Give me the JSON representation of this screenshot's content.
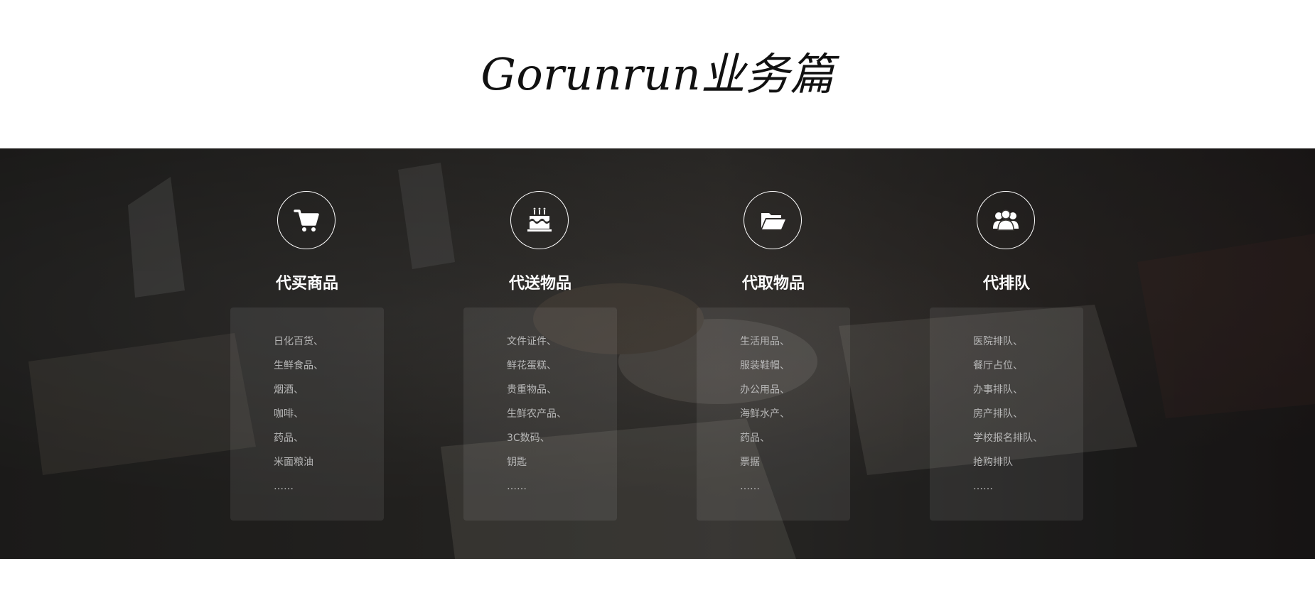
{
  "page": {
    "title": "Gorunrun业务篇"
  },
  "services": [
    {
      "title": "代买商品",
      "icon": "shopping-cart-icon",
      "items": [
        "日化百货、",
        "生鲜食品、",
        "烟酒、",
        "咖啡、",
        "药品、",
        "米面粮油",
        "……"
      ]
    },
    {
      "title": "代送物品",
      "icon": "birthday-cake-icon",
      "items": [
        "文件证件、",
        "鲜花蛋糕、",
        "贵重物品、",
        "生鲜农产品、",
        "3C数码、",
        "钥匙",
        "……"
      ]
    },
    {
      "title": "代取物品",
      "icon": "open-folder-icon",
      "items": [
        "生活用品、",
        "服装鞋帽、",
        "办公用品、",
        "海鲜水产、",
        "药品、",
        "票据",
        "……"
      ]
    },
    {
      "title": "代排队",
      "icon": "people-group-icon",
      "items": [
        "医院排队、",
        "餐厅占位、",
        "办事排队、",
        "房产排队、",
        "学校报名排队、",
        "抢购排队",
        "……"
      ]
    }
  ],
  "colors": {
    "icon_stroke": "#ffffff",
    "list_text": "#b8b8b8",
    "band_base": "#2f2d2b"
  }
}
